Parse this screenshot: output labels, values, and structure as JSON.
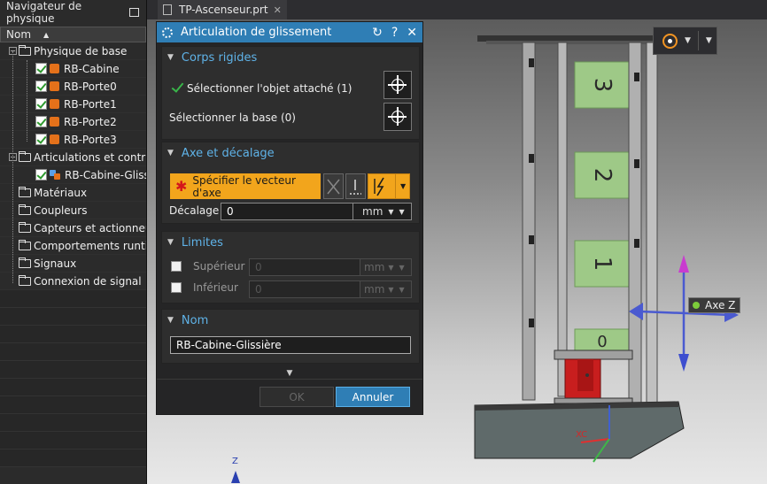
{
  "navigator": {
    "title": "Navigateur de physique",
    "column_header": "Nom",
    "items": [
      {
        "label": "Physique de base",
        "level": 0,
        "type": "folder",
        "expander": "−"
      },
      {
        "label": "RB-Cabine",
        "level": 1,
        "type": "body"
      },
      {
        "label": "RB-Porte0",
        "level": 1,
        "type": "body"
      },
      {
        "label": "RB-Porte1",
        "level": 1,
        "type": "body"
      },
      {
        "label": "RB-Porte2",
        "level": 1,
        "type": "body"
      },
      {
        "label": "RB-Porte3",
        "level": 1,
        "type": "body"
      },
      {
        "label": "Articulations et contrai",
        "level": 0,
        "type": "folder",
        "expander": "−"
      },
      {
        "label": "RB-Cabine-Gliss",
        "level": 1,
        "type": "joint"
      },
      {
        "label": "Matériaux",
        "level": 0,
        "type": "folder"
      },
      {
        "label": "Coupleurs",
        "level": 0,
        "type": "folder"
      },
      {
        "label": "Capteurs et actionneur",
        "level": 0,
        "type": "folder"
      },
      {
        "label": "Comportements runtir",
        "level": 0,
        "type": "folder"
      },
      {
        "label": "Signaux",
        "level": 0,
        "type": "folder"
      },
      {
        "label": "Connexion de signal",
        "level": 0,
        "type": "folder"
      }
    ]
  },
  "tab": {
    "label": "TP-Ascenseur.prt",
    "close": "✕"
  },
  "dialog": {
    "title": "Articulation de glissement",
    "title_buttons": [
      "↻",
      "?",
      "✕"
    ],
    "sections": {
      "rigid": {
        "title": "Corps rigides",
        "select_attached": "Sélectionner l'objet attaché (1)",
        "select_base": "Sélectionner la base (0)"
      },
      "axis": {
        "title": "Axe et décalage",
        "vector_label": "Spécifier le vecteur d'axe",
        "required": "✱",
        "offset_label": "Décalage",
        "offset_value": "0",
        "offset_unit": "mm"
      },
      "limits": {
        "title": "Limites",
        "upper_label": "Supérieur",
        "upper_value": "0",
        "upper_unit": "mm",
        "lower_label": "Inférieur",
        "lower_value": "0",
        "lower_unit": "mm"
      },
      "name": {
        "title": "Nom",
        "value": "RB-Cabine-Glissière"
      }
    },
    "buttons": {
      "ok": "OK",
      "cancel": "Annuler"
    }
  },
  "viewport": {
    "axis_tag": "Axe Z",
    "floor_numbers": [
      "3",
      "2",
      "1",
      "0"
    ],
    "labels": {
      "xc": "XC",
      "z": "Z"
    }
  },
  "colors": {
    "accent": "#2f7eb5",
    "orange": "#f2a51c",
    "section_title": "#5fb3e8",
    "panel_green": "#9ec987"
  }
}
